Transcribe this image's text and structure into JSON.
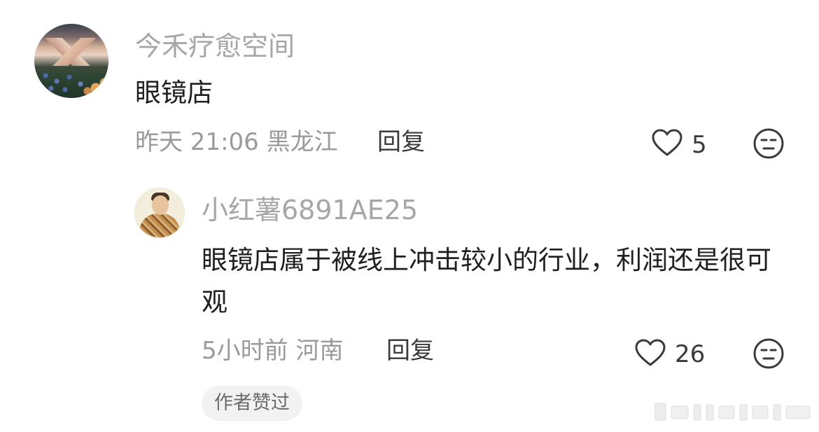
{
  "comments": [
    {
      "username": "今禾疗愈空间",
      "content": "眼镜店",
      "meta": "昨天 21:06 黑龙江",
      "reply_label": "回复",
      "likes": "5"
    },
    {
      "username": "小红薯6891AE25",
      "content": "眼镜店属于被线上冲击较小的行业，利润还是很可观",
      "meta": "5小时前 河南",
      "reply_label": "回复",
      "likes": "26",
      "badge": "作者赞过"
    }
  ],
  "icons": {
    "like": "heart-outline",
    "dislike": "unamused-face"
  }
}
